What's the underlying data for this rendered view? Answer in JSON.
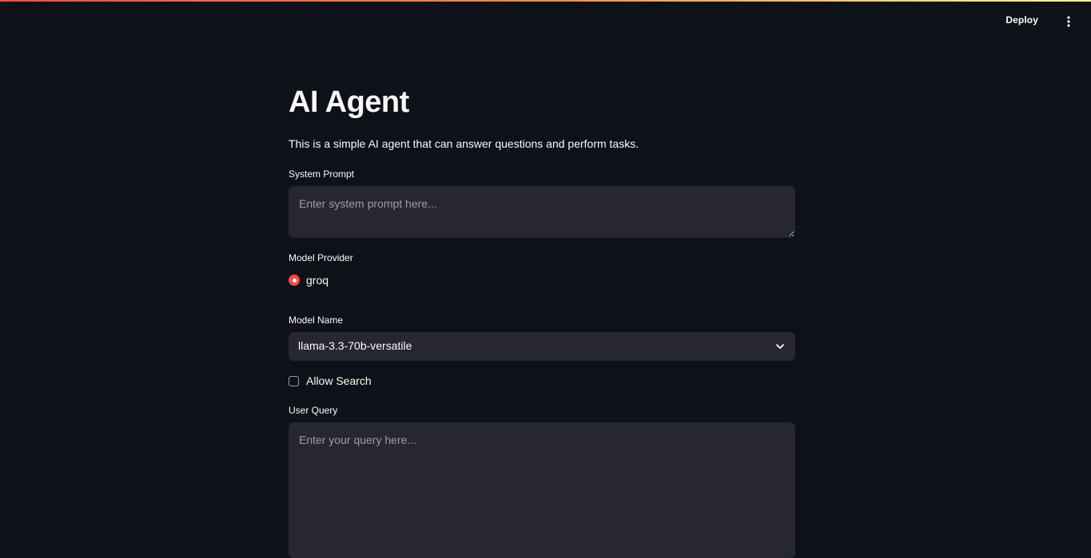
{
  "header": {
    "deploy_label": "Deploy",
    "menu_icon": "vertical-ellipsis-icon"
  },
  "colors": {
    "background": "#0e1117",
    "input_background": "#262730",
    "accent": "#ff4b4b",
    "text": "#fafafa",
    "placeholder": "#9c9da5"
  },
  "main": {
    "title": "AI Agent",
    "description": "This is a simple AI agent that can answer questions and perform tasks.",
    "system_prompt": {
      "label": "System Prompt",
      "placeholder": "Enter system prompt here...",
      "value": ""
    },
    "model_provider": {
      "label": "Model Provider",
      "options": [
        "groq"
      ],
      "selected": "groq"
    },
    "model_name": {
      "label": "Model Name",
      "selected": "llama-3.3-70b-versatile"
    },
    "allow_search": {
      "label": "Allow Search",
      "checked": false
    },
    "user_query": {
      "label": "User Query",
      "placeholder": "Enter your query here...",
      "value": ""
    }
  }
}
